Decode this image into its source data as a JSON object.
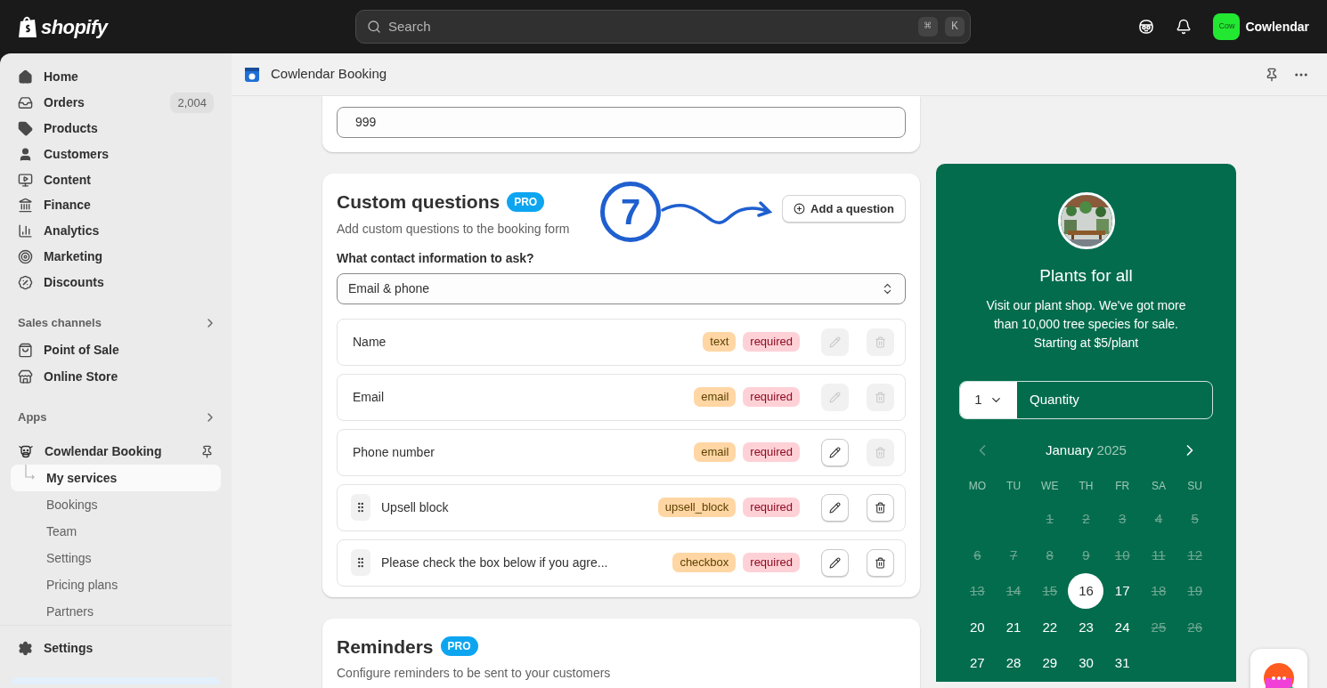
{
  "topbar": {
    "logo": "shopify",
    "search": {
      "placeholder": "Search",
      "keys": [
        "⌘",
        "K"
      ]
    },
    "store": {
      "avatar": "Cow",
      "name": "Cowlendar"
    }
  },
  "sidebar": {
    "items": [
      {
        "label": "Home",
        "selected": false
      },
      {
        "label": "Orders",
        "badge": "2,004",
        "selected": false
      },
      {
        "label": "Products",
        "selected": false
      },
      {
        "label": "Customers",
        "selected": false
      },
      {
        "label": "Content",
        "selected": false
      },
      {
        "label": "Finance",
        "selected": false
      },
      {
        "label": "Analytics",
        "selected": false
      },
      {
        "label": "Marketing",
        "selected": false
      },
      {
        "label": "Discounts",
        "selected": false
      }
    ],
    "sections": [
      {
        "title": "Sales channels",
        "items": [
          {
            "label": "Point of Sale"
          },
          {
            "label": "Online Store"
          }
        ]
      },
      {
        "title": "Apps",
        "items": [
          {
            "label": "Cowlendar Booking",
            "pinned": true,
            "children": [
              {
                "label": "My services",
                "selected": true
              },
              {
                "label": "Bookings",
                "selected": false
              },
              {
                "label": "Team",
                "selected": false
              },
              {
                "label": "Settings",
                "selected": false
              },
              {
                "label": "Pricing plans",
                "selected": false
              },
              {
                "label": "Partners",
                "selected": false
              }
            ]
          }
        ]
      }
    ],
    "footer": {
      "label": "Settings"
    }
  },
  "page": {
    "title": "Cowlendar Booking"
  },
  "capacity": {
    "value": "999"
  },
  "custom_questions": {
    "title": "Custom questions",
    "badge": "PRO",
    "subtitle": "Add custom questions to the booking form",
    "add_button": "Add a question",
    "step": "7",
    "contact_label": "What contact information to ask?",
    "contact_value": "Email & phone",
    "questions": [
      {
        "name": "Name",
        "type": "text",
        "required": "required",
        "draggable": false,
        "edit_disabled": true,
        "delete_disabled": true
      },
      {
        "name": "Email",
        "type": "email",
        "required": "required",
        "draggable": false,
        "edit_disabled": true,
        "delete_disabled": true
      },
      {
        "name": "Phone number",
        "type": "email",
        "required": "required",
        "draggable": false,
        "edit_disabled": false,
        "delete_disabled": true
      },
      {
        "name": "Upsell block",
        "type": "upsell_block",
        "required": "required",
        "draggable": true,
        "edit_disabled": false,
        "delete_disabled": false
      },
      {
        "name": "Please check the box below if you agre...",
        "type": "checkbox",
        "required": "required",
        "draggable": true,
        "edit_disabled": false,
        "delete_disabled": false
      }
    ]
  },
  "reminders": {
    "title": "Reminders",
    "badge": "PRO",
    "subtitle": "Configure reminders to be sent to your customers"
  },
  "preview": {
    "title": "Plants for all",
    "description": "Visit our plant shop. We've got more than 10,000 tree species for sale. Starting at $5/plant",
    "quantity": "1",
    "quantity_label": "Quantity",
    "calendar": {
      "month": "January",
      "year": "2025",
      "prev_disabled": true,
      "weekdays": [
        "MO",
        "TU",
        "WE",
        "TH",
        "FR",
        "SA",
        "SU"
      ],
      "weeks": [
        {
          "days": [
            {
              "label": "1",
              "disabled": true,
              "selected": false
            },
            {
              "label": "2",
              "disabled": true,
              "selected": false
            },
            {
              "label": "3",
              "disabled": true,
              "selected": false
            },
            {
              "label": "4",
              "disabled": true,
              "selected": false
            },
            {
              "label": "5",
              "disabled": true,
              "selected": false
            }
          ]
        },
        {
          "days": [
            {
              "label": "6",
              "disabled": true,
              "selected": false
            },
            {
              "label": "7",
              "disabled": true,
              "selected": false
            },
            {
              "label": "8",
              "disabled": true,
              "selected": false
            },
            {
              "label": "9",
              "disabled": true,
              "selected": false
            },
            {
              "label": "10",
              "disabled": true,
              "selected": false
            },
            {
              "label": "11",
              "disabled": true,
              "selected": false
            },
            {
              "label": "12",
              "disabled": true,
              "selected": false
            }
          ]
        },
        {
          "days": [
            {
              "label": "13",
              "disabled": true,
              "selected": false
            },
            {
              "label": "14",
              "disabled": true,
              "selected": false
            },
            {
              "label": "15",
              "disabled": true,
              "selected": false
            },
            {
              "label": "16",
              "disabled": false,
              "selected": true
            },
            {
              "label": "17",
              "disabled": false,
              "selected": false
            },
            {
              "label": "18",
              "disabled": true,
              "selected": false
            },
            {
              "label": "19",
              "disabled": true,
              "selected": false
            }
          ]
        },
        {
          "days": [
            {
              "label": "20",
              "disabled": false,
              "selected": false
            },
            {
              "label": "21",
              "disabled": false,
              "selected": false
            },
            {
              "label": "22",
              "disabled": false,
              "selected": false
            },
            {
              "label": "23",
              "disabled": false,
              "selected": false
            },
            {
              "label": "24",
              "disabled": false,
              "selected": false
            },
            {
              "label": "25",
              "disabled": true,
              "selected": false
            },
            {
              "label": "26",
              "disabled": true,
              "selected": false
            }
          ]
        },
        {
          "days": [
            {
              "label": "27",
              "disabled": false,
              "selected": false
            },
            {
              "label": "28",
              "disabled": false,
              "selected": false
            },
            {
              "label": "29",
              "disabled": false,
              "selected": false
            },
            {
              "label": "30",
              "disabled": false,
              "selected": false
            },
            {
              "label": "31",
              "disabled": false,
              "selected": false
            }
          ]
        }
      ]
    }
  }
}
